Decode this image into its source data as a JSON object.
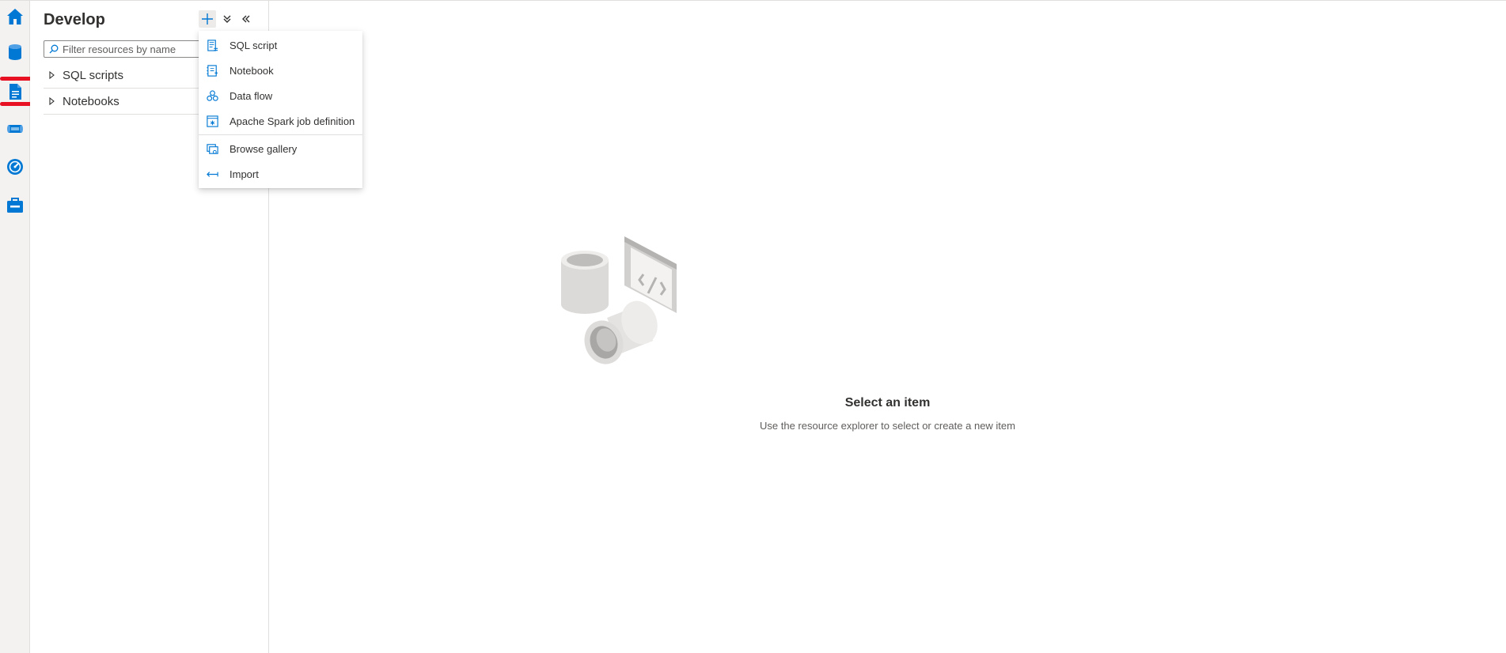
{
  "rail": {
    "items": [
      {
        "name": "home-icon"
      },
      {
        "name": "data-icon"
      },
      {
        "name": "develop-icon"
      },
      {
        "name": "integrate-icon"
      },
      {
        "name": "monitor-icon"
      },
      {
        "name": "manage-icon"
      }
    ],
    "accent_color": "#0078d4",
    "marker_color": "#e81123"
  },
  "panel": {
    "title": "Develop",
    "add_icon": "plus-icon",
    "expand_icon": "expand-all-icon",
    "collapse_icon": "collapse-panel-icon",
    "search": {
      "placeholder": "Filter resources by name",
      "value": ""
    },
    "tree": [
      {
        "label": "SQL scripts"
      },
      {
        "label": "Notebooks"
      }
    ]
  },
  "menu": {
    "items": [
      {
        "label": "SQL script",
        "icon": "sql-script-icon"
      },
      {
        "label": "Notebook",
        "icon": "notebook-icon"
      },
      {
        "label": "Data flow",
        "icon": "data-flow-icon"
      },
      {
        "label": "Apache Spark job definition",
        "icon": "spark-job-icon"
      },
      {
        "label": "Browse gallery",
        "icon": "gallery-icon"
      },
      {
        "label": "Import",
        "icon": "import-icon"
      }
    ]
  },
  "main": {
    "empty_title": "Select an item",
    "empty_subtitle": "Use the resource explorer to select or create a new item"
  }
}
